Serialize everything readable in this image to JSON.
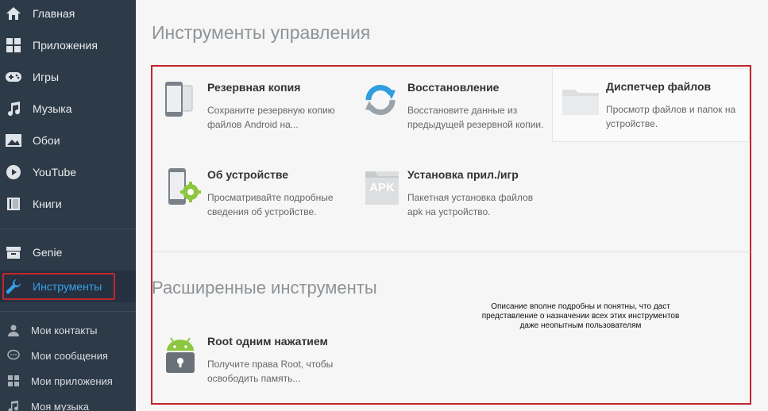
{
  "sidebar": {
    "items": [
      {
        "label": "Главная",
        "icon": "home-icon"
      },
      {
        "label": "Приложения",
        "icon": "apps-grid-icon"
      },
      {
        "label": "Игры",
        "icon": "gamepad-icon"
      },
      {
        "label": "Музыка",
        "icon": "music-note-icon"
      },
      {
        "label": "Обои",
        "icon": "wallpaper-icon"
      },
      {
        "label": "YouTube",
        "icon": "play-icon"
      },
      {
        "label": "Книги",
        "icon": "book-icon"
      }
    ],
    "genie": {
      "label": "Genie",
      "icon": "genie-box-icon"
    },
    "tools": {
      "label": "Инструменты",
      "icon": "wrench-icon"
    },
    "personal": [
      {
        "label": "Мои контакты",
        "icon": "person-icon"
      },
      {
        "label": "Мои сообщения",
        "icon": "chat-icon"
      },
      {
        "label": "Мои приложения",
        "icon": "apps-grid-icon"
      },
      {
        "label": "Моя музыка",
        "icon": "music-note-icon"
      }
    ]
  },
  "main": {
    "title": "Инструменты управления",
    "tools": [
      {
        "name": "Резервная копия",
        "desc": "Сохраните резервную копию файлов Android на...",
        "icon": "backup-phones-icon"
      },
      {
        "name": "Восстановление",
        "desc": "Восстановите данные из предыдущей резервной копии.",
        "icon": "restore-arrows-icon"
      },
      {
        "name": "Диспетчер файлов",
        "desc": "Просмотр файлов и папок на устройстве.",
        "icon": "folder-icon"
      },
      {
        "name": "Об устройстве",
        "desc": "Просматривайте подробные сведения об устройстве.",
        "icon": "device-gear-icon"
      },
      {
        "name": "Установка прил./игр",
        "desc": "Пакетная установка файлов apk на устройство.",
        "icon": "apk-icon",
        "icon_text": "APK"
      }
    ],
    "advanced_title": "Расширенные инструменты",
    "advanced_tools": [
      {
        "name": "Root одним нажатием",
        "desc": "Получите права Root, чтобы освободить память...",
        "icon": "android-lock-icon"
      }
    ],
    "note": "Описание вполне подробны и понятны, что даст представление о назначении всех этих инструментов даже неопытным пользователям"
  },
  "colors": {
    "sidebar_bg": "#2d3a47",
    "accent_blue": "#3aa0ea",
    "annotation_red": "#c1272d",
    "android_green": "#8dc63f"
  }
}
